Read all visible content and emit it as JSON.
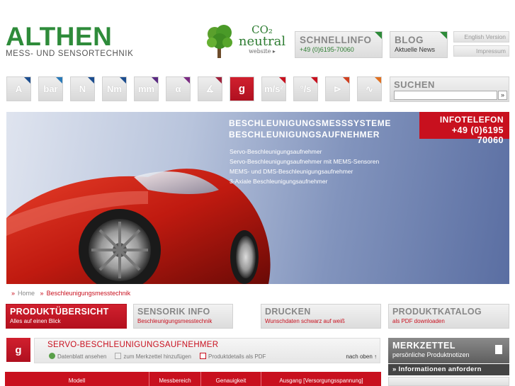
{
  "logo": {
    "main": "ALTHEN",
    "sub": "MESS- UND SENSORTECHNIK"
  },
  "co2": {
    "top": "CO₂",
    "mid": "neutral",
    "bot": "website ▸"
  },
  "header": {
    "schnellinfo": {
      "title": "SCHNELLINFO",
      "sub": "+49 (0)6195-70060"
    },
    "blog": {
      "title": "BLOG",
      "sub": "Aktuelle News"
    },
    "english": "English Version",
    "impressum": "Impressum"
  },
  "icons": [
    {
      "label": "A",
      "corner": "#1d4e8f"
    },
    {
      "label": "bar",
      "corner": "#2a7ab8"
    },
    {
      "label": "N",
      "corner": "#1d4e8f"
    },
    {
      "label": "Nm",
      "corner": "#1d4e8f"
    },
    {
      "label": "mm",
      "corner": "#5a2a82"
    },
    {
      "label": "α",
      "corner": "#7a2a82"
    },
    {
      "label": "∡",
      "corner": "#a0203a"
    },
    {
      "label": "g",
      "corner": "#c8101e"
    },
    {
      "label": "m/s²",
      "corner": "#c8101e"
    },
    {
      "label": "°/s",
      "corner": "#c8101e"
    },
    {
      "label": "⊳",
      "corner": "#d04020"
    },
    {
      "label": "∿",
      "corner": "#e07020"
    }
  ],
  "search": {
    "title": "SUCHEN",
    "placeholder": "",
    "go": "»"
  },
  "banner": {
    "title1": "BESCHLEUNIGUNGSMESSSYSTEME",
    "title2": "BESCHLEUNIGUNGSAUFNEHMER",
    "items": [
      "Servo-Beschleunigungsaufnehmer",
      "Servo-Beschleunigungsaufnehmer mit MEMS-Sensoren",
      "MEMS- und DMS-Beschleunigungsaufnehmer",
      "3-Axiale Beschleunigungsaufnehmer"
    ],
    "infotel_label": "INFOTELEFON",
    "infotel_number": "+49 (0)6195 70060"
  },
  "breadcrumb": {
    "home": "Home",
    "current": "Beschleunigungsmesstechnik",
    "sep": "»"
  },
  "tabs": [
    {
      "title": "PRODUKTÜBERSICHT",
      "sub": "Alles auf einen Blick"
    },
    {
      "title": "SENSORIK INFO",
      "sub": "Beschleunigungsmesstechnik"
    },
    {
      "title": "DRUCKEN",
      "sub": "Wunschdaten schwarz auf weiß"
    },
    {
      "title": "PRODUKTKATALOG",
      "sub": "als PDF downloaden"
    }
  ],
  "product": {
    "icon": "g",
    "title": "SERVO-BESCHLEUNIGUNGSAUFNEHMER",
    "links": [
      "Datenblatt ansehen",
      "zum Merkzettel hinzufügen",
      "Produktdetails als PDF"
    ],
    "top": "nach oben ↑"
  },
  "table": {
    "columns": [
      "Modell",
      "Messbereich",
      "Genauigkeit",
      "Ausgang [Versorgungsspannung]"
    ]
  },
  "merkzettel": {
    "title": "MERKZETTEL",
    "sub": "persönliche Produktnotizen",
    "button": "»  Informationen anfordern"
  }
}
